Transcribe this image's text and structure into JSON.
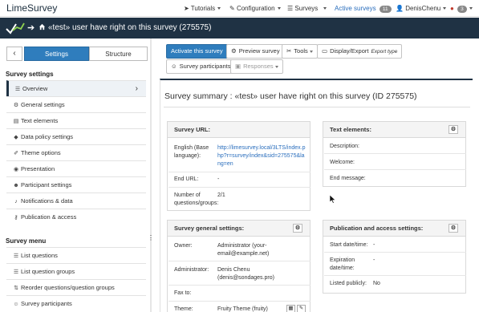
{
  "navbar": {
    "brand": "LimeSurvey",
    "tutorials": "Tutorials",
    "configuration": "Configuration",
    "surveys": "Surveys",
    "active_surveys": "Active surveys",
    "active_count": "11",
    "user": "DenisChenu",
    "notifications_count": "3"
  },
  "surveybar": {
    "title": "«test» user have right on this survey (275575)"
  },
  "sidebar": {
    "tab_settings": "Settings",
    "tab_structure": "Structure",
    "settings_heading": "Survey settings",
    "settings_items": [
      {
        "label": "Overview",
        "icon": "list-icon"
      },
      {
        "label": "General settings",
        "icon": "cogs-icon"
      },
      {
        "label": "Text elements",
        "icon": "file-text-icon"
      },
      {
        "label": "Data policy settings",
        "icon": "shield-icon"
      },
      {
        "label": "Theme options",
        "icon": "paint-brush-icon"
      },
      {
        "label": "Presentation",
        "icon": "eye-icon"
      },
      {
        "label": "Participant settings",
        "icon": "users-icon"
      },
      {
        "label": "Notifications & data",
        "icon": "bell-icon"
      },
      {
        "label": "Publication & access",
        "icon": "key-icon"
      }
    ],
    "menu_heading": "Survey menu",
    "menu_items": [
      {
        "label": "List questions",
        "icon": "list-icon"
      },
      {
        "label": "List question groups",
        "icon": "list-icon"
      },
      {
        "label": "Reorder questions/question groups",
        "icon": "sort-icon"
      },
      {
        "label": "Survey participants",
        "icon": "user-icon"
      }
    ]
  },
  "toolbar": {
    "activate": "Activate this survey",
    "preview": "Preview survey",
    "tools": "Tools",
    "display_export": "Display/Export",
    "export_type": "Export type",
    "participants": "Survey participants",
    "responses": "Responses"
  },
  "main": {
    "title": "Survey summary : «test» user have right on this survey (ID 275575)",
    "survey_url": {
      "heading": "Survey URL:",
      "english_label": "English (Base language):",
      "english_url": "http://limesurvey.local/3LTS/index.php?r=survey/index&sid=275575&lang=en",
      "end_url_label": "End URL:",
      "end_url_value": "-",
      "num_label": "Number of questions/groups:",
      "num_value": "2/1"
    },
    "text_elements": {
      "heading": "Text elements:",
      "description": "Description:",
      "welcome": "Welcome:",
      "end_message": "End message:"
    },
    "general": {
      "heading": "Survey general settings:",
      "owner_label": "Owner:",
      "owner_value": "Administrator (your-email@example.net)",
      "admin_label": "Administrator:",
      "admin_value": "Denis Chenu (denis@sondages.pro)",
      "fax_label": "Fax to:",
      "fax_value": "",
      "theme_label": "Theme:",
      "theme_value": "Fruity Theme (fruity)"
    },
    "publication": {
      "heading": "Publication and access settings:",
      "start_label": "Start date/time:",
      "start_value": "-",
      "expiry_label": "Expiration date/time:",
      "expiry_value": "-",
      "listed_label": "Listed publicly:",
      "listed_value": "No"
    }
  },
  "colors": {
    "dark_bar": "#1f3244",
    "primary": "#2f7dbd",
    "link": "#2a6ebd"
  }
}
